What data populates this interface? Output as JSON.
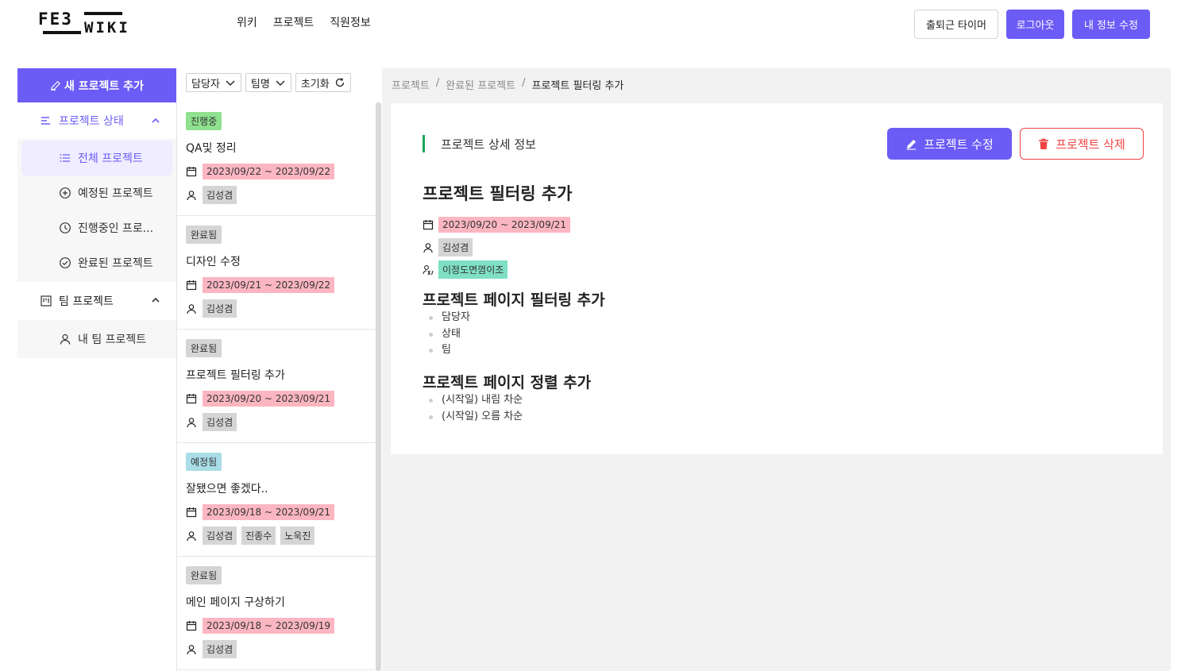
{
  "header": {
    "logo_top": "FE3",
    "logo_bottom": "WIKI",
    "nav": [
      "위키",
      "프로젝트",
      "직원정보"
    ],
    "timer_label": "출퇴근 타이머",
    "logout_label": "로그아웃",
    "myinfo_label": "내 정보 수정"
  },
  "sidebar": {
    "add_label": "새 프로젝트 추가",
    "status_group": "프로젝트 상태",
    "status_items": [
      "전체 프로젝트",
      "예정된 프로젝트",
      "진행중인 프로...",
      "완료된 프로젝트"
    ],
    "team_group": "팀 프로젝트",
    "team_items": [
      "내 팀 프로젝트"
    ]
  },
  "filters": {
    "assignee": "담당자",
    "team": "팀명",
    "reset": "초기화"
  },
  "projects": [
    {
      "status": "진행중",
      "title": "QA및 정리",
      "dates": "2023/09/22 ~ 2023/09/22",
      "people": [
        "김성겸"
      ]
    },
    {
      "status": "완료됨",
      "title": "디자인 수정",
      "dates": "2023/09/21 ~ 2023/09/22",
      "people": [
        "김성겸"
      ]
    },
    {
      "status": "완료됨",
      "title": "프로젝트 필터링 추가",
      "dates": "2023/09/20 ~ 2023/09/21",
      "people": [
        "김성겸"
      ]
    },
    {
      "status": "예정됨",
      "title": "잘됐으면 좋겠다..",
      "dates": "2023/09/18 ~ 2023/09/21",
      "people": [
        "김성겸",
        "진종수",
        "노욱진"
      ]
    },
    {
      "status": "완료됨",
      "title": "메인 페이지 구상하기",
      "dates": "2023/09/18 ~ 2023/09/19",
      "people": [
        "김성겸"
      ]
    }
  ],
  "breadcrumb": [
    "프로젝트",
    "완료된 프로젝트",
    "프로젝트 필터링 추가"
  ],
  "detail": {
    "section_title": "프로젝트 상세 정보",
    "edit_label": "프로젝트 수정",
    "delete_label": "프로젝트 삭제",
    "title": "프로젝트 필터링 추가",
    "dates": "2023/09/20 ~ 2023/09/21",
    "person": "김성겸",
    "team": "이정도면껌이조",
    "heading1": "프로젝트 페이지 필터링 추가",
    "list1": [
      "담당자",
      "상태",
      "팀"
    ],
    "heading2": "프로젝트 페이지 정렬 추가",
    "list2": [
      "(시작일) 내림 차순",
      "(시작일) 오름 차순"
    ]
  },
  "colors": {
    "accent": "#6b5cf5",
    "status_in_progress": "#8fe08f",
    "status_done": "#d5d5d5",
    "status_planned": "#a9dde8",
    "date_tag": "#fbb6c1",
    "team_tag": "#7fe0c4",
    "danger": "#ef4444"
  }
}
